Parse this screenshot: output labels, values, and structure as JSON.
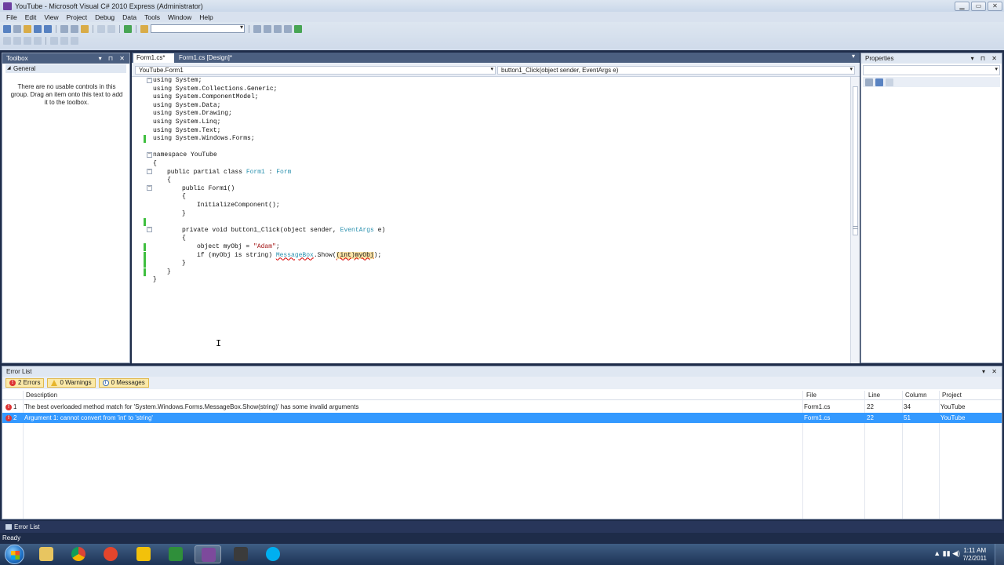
{
  "window": {
    "title": "YouTube - Microsoft Visual C# 2010 Express (Administrator)",
    "minimize": "▁",
    "maximize": "▭",
    "close": "✕"
  },
  "menu": [
    "File",
    "Edit",
    "View",
    "Project",
    "Debug",
    "Data",
    "Tools",
    "Window",
    "Help"
  ],
  "toolbox": {
    "title": "Toolbox",
    "controls": "▾ ⊓ ✕",
    "group": "General",
    "message": "There are no usable controls in this group. Drag an item onto this text to add it to the toolbox."
  },
  "editor": {
    "tabs": [
      {
        "label": "Form1.cs*"
      },
      {
        "label": "Form1.cs [Design]*"
      }
    ],
    "tab_menu": "▾",
    "nav_left": "YouTube.Form1",
    "nav_right": "button1_Click(object sender, EventArgs e)"
  },
  "code": {
    "l1": "using System;",
    "l2": "using System.Collections.Generic;",
    "l3": "using System.ComponentModel;",
    "l4": "using System.Data;",
    "l5": "using System.Drawing;",
    "l6": "using System.Linq;",
    "l7": "using System.Text;",
    "l8": "using System.Windows.Forms;",
    "l10": "namespace YouTube",
    "l11": "{",
    "l12a": "public partial class ",
    "l12b": "Form1",
    "l12c": " : ",
    "l12d": "Form",
    "l13": "{",
    "l14": "public Form1()",
    "l15": "{",
    "l16": "InitializeComponent();",
    "l17": "}",
    "l19a": "private void button1_Click(object sender, ",
    "l19b": "EventArgs",
    "l19c": " e)",
    "l20": "{",
    "l21a": "object myObj = ",
    "l21b": "\"Adam\"",
    "l21c": ";",
    "l22a": "if (myObj is string) ",
    "l22b": "MessageBox",
    "l22c": ".Show(",
    "l22d": "(int)myObj",
    "l22e": ");",
    "l23": "}",
    "l24": "}",
    "l25": "}",
    "fold": "−"
  },
  "properties": {
    "title": "Properties",
    "controls": "▾ ⊓ ✕"
  },
  "errors": {
    "title": "Error List",
    "controls": "▾ ✕",
    "filters": {
      "errors": "2 Errors",
      "warnings": "0 Warnings",
      "messages": "0 Messages"
    },
    "icons": {
      "error": "!",
      "info": "i"
    },
    "headers": {
      "description": "Description",
      "file": "File",
      "line": "Line",
      "column": "Column",
      "project": "Project"
    },
    "rows": [
      {
        "num": "1",
        "description": "The best overloaded method match for 'System.Windows.Forms.MessageBox.Show(string)' has some invalid arguments",
        "file": "Form1.cs",
        "line": "22",
        "column": "34",
        "project": "YouTube"
      },
      {
        "num": "2",
        "description": "Argument 1: cannot convert from 'int' to 'string'",
        "file": "Form1.cs",
        "line": "22",
        "column": "51",
        "project": "YouTube"
      }
    ]
  },
  "bottom_tab": "Error List",
  "status": "Ready",
  "taskbar": {
    "tray": "▲  ▮▮  ◀)",
    "time": "1:11 AM",
    "date": "7/2/2011"
  },
  "cursor_glyph": "I",
  "colors": {
    "accent": "#3399ff",
    "panel_header": "#4b5f80",
    "error_red": "#d33333",
    "change_green": "#3fbf3f"
  }
}
